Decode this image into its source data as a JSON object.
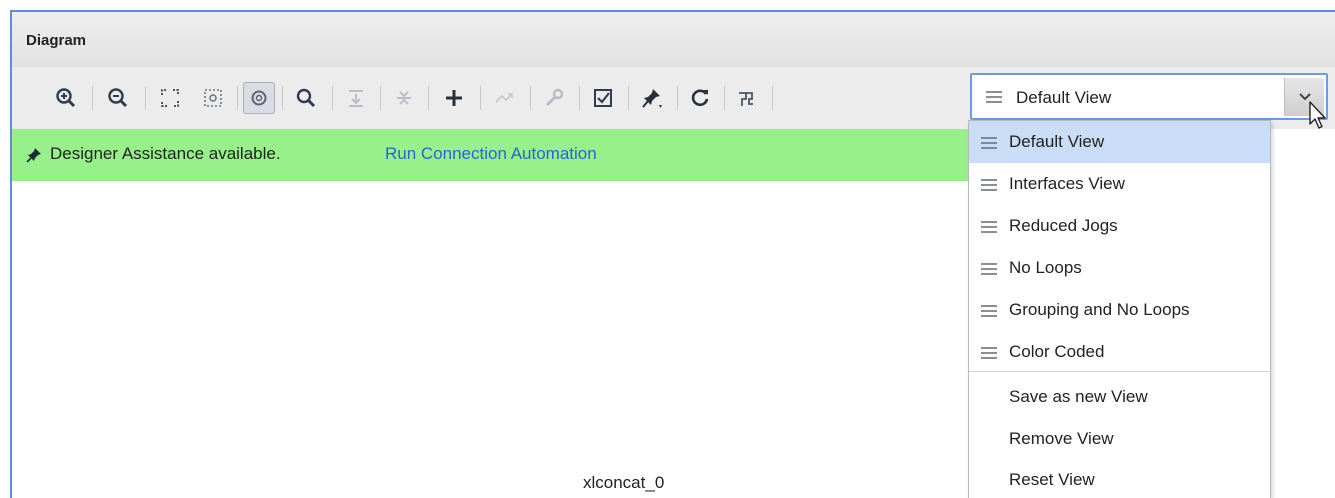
{
  "panel": {
    "title": "Diagram"
  },
  "toolbar": {
    "buttons": [
      {
        "icon": "zoom-in-icon"
      },
      {
        "icon": "zoom-out-icon"
      },
      {
        "icon": "zoom-fit-icon"
      },
      {
        "icon": "zoom-area-icon"
      },
      {
        "icon": "auto-fit-icon",
        "selected": true
      },
      {
        "icon": "search-icon"
      },
      {
        "icon": "expand-all-icon"
      },
      {
        "icon": "collapse-all-icon"
      },
      {
        "icon": "add-ip-icon"
      },
      {
        "icon": "route-icon"
      },
      {
        "icon": "validate-tools-icon"
      },
      {
        "icon": "validate-design-icon"
      },
      {
        "icon": "pin-icon"
      },
      {
        "icon": "regenerate-layout-icon"
      },
      {
        "icon": "optimize-routing-icon"
      }
    ]
  },
  "banner": {
    "message": "Designer Assistance available.",
    "link": "Run Connection Automation",
    "color": "#98f08b"
  },
  "view_select": {
    "selected": "Default View",
    "options": [
      "Default View",
      "Interfaces View",
      "Reduced Jogs",
      "No Loops",
      "Grouping and No Loops",
      "Color Coded"
    ],
    "actions": [
      "Save as new View",
      "Remove View",
      "Reset View"
    ]
  },
  "canvas": {
    "partial_label": "xlconcat_0"
  },
  "colors": {
    "accent": "#5b8ed6",
    "link": "#2a63d8",
    "highlight": "#c9ddf6"
  }
}
